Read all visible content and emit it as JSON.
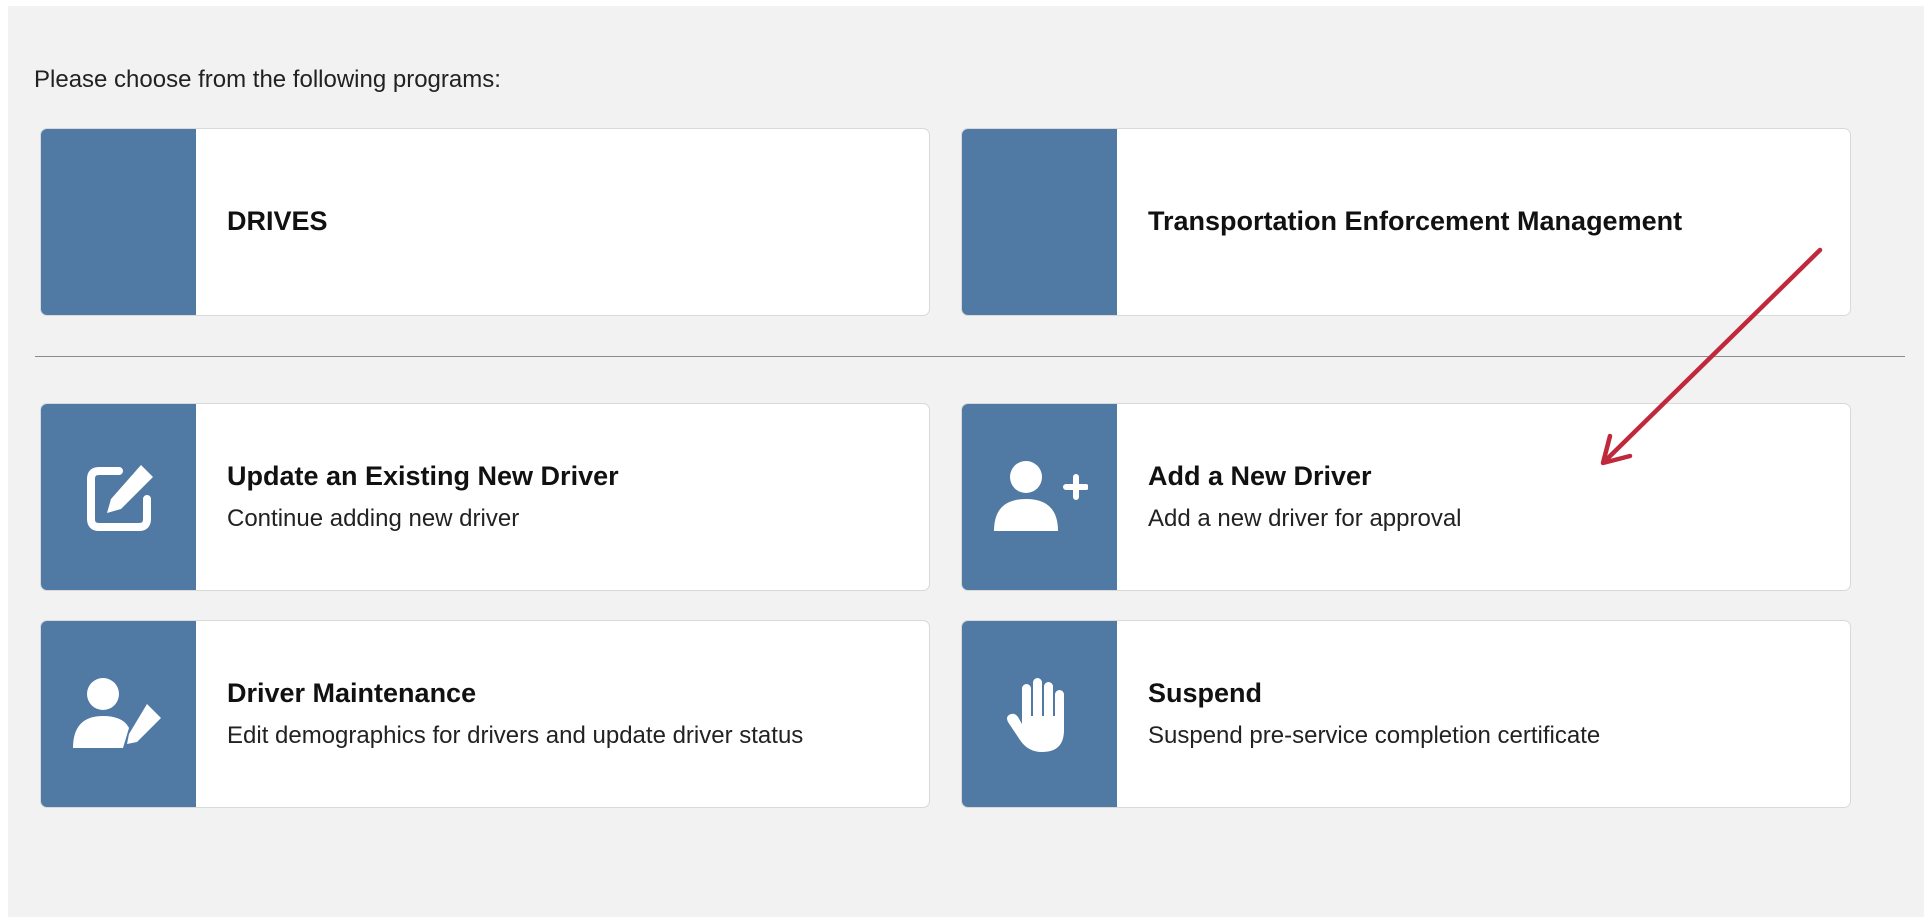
{
  "intro_text": "Please choose from the following programs:",
  "colors": {
    "tile_accent": "#5079a3",
    "annotation_arrow": "#c0283b"
  },
  "programs": [
    {
      "title": "DRIVES"
    },
    {
      "title": "Transportation Enforcement Management"
    }
  ],
  "actions": [
    {
      "title": "Update an Existing New Driver",
      "description": "Continue adding new driver",
      "icon": "edit-icon"
    },
    {
      "title": "Add a New Driver",
      "description": "Add a new driver for approval",
      "icon": "add-user-icon"
    },
    {
      "title": "Driver Maintenance",
      "description": "Edit demographics for drivers and update driver status",
      "icon": "user-edit-icon"
    },
    {
      "title": "Suspend",
      "description": "Suspend pre-service completion certificate",
      "icon": "hand-stop-icon"
    }
  ]
}
